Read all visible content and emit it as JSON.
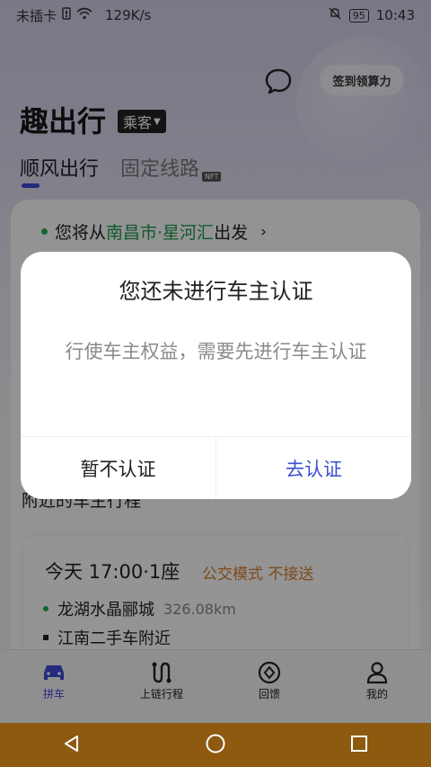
{
  "status_bar": {
    "carrier": "未插卡",
    "speed": "129K/s",
    "battery": "95",
    "time": "10:43"
  },
  "header": {
    "sign_in_button": "签到领算力",
    "app_title": "趣出行",
    "role": "乘客",
    "tabs": [
      {
        "label": "顺风出行",
        "active": true
      },
      {
        "label": "固定线路",
        "badge": "NFT",
        "active": false
      }
    ]
  },
  "main": {
    "origin_prefix": "您将从",
    "origin_place": "南昌市·星河汇",
    "origin_suffix": "出发",
    "section_title": "附近的车主行程",
    "trip": {
      "time": "今天 17:00·1座",
      "mode": "公交模式 不接送",
      "stops": [
        {
          "name": "龙湖水晶郦城",
          "distance": "326.08km"
        },
        {
          "name": "江南二手车附近"
        }
      ]
    }
  },
  "bottom_nav": [
    {
      "label": "拼车",
      "icon": "car-icon",
      "active": true
    },
    {
      "label": "上链行程",
      "icon": "route-icon",
      "active": false
    },
    {
      "label": "回馈",
      "icon": "feedback-icon",
      "active": false
    },
    {
      "label": "我的",
      "icon": "person-icon",
      "active": false
    }
  ],
  "dialog": {
    "title": "您还未进行车主认证",
    "message": "行使车主权益，需要先进行车主认证",
    "cancel_label": "暂不认证",
    "confirm_label": "去认证"
  },
  "colors": {
    "accent": "#3e49d8",
    "green": "#1fb05a",
    "orange": "#d67f2c",
    "system_nav": "#8d5a10"
  }
}
